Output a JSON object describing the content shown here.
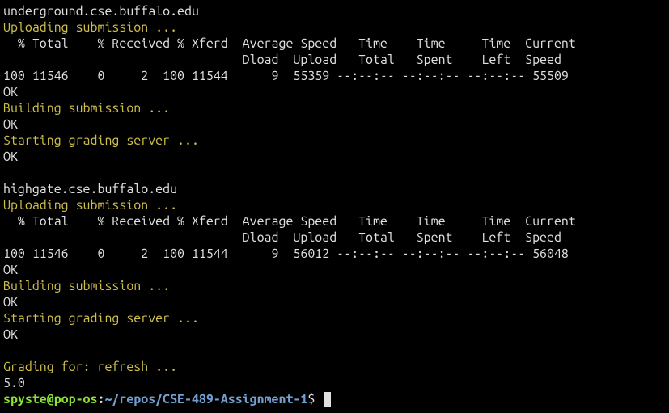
{
  "block1": {
    "host": "underground.cse.buffalo.edu",
    "uploading": "Uploading submission ...",
    "header1": "  % Total    % Received % Xferd  Average Speed   Time    Time     Time  Current",
    "header2": "                                 Dload  Upload   Total   Spent    Left  Speed",
    "progress": "100 11546    0     2  100 11544      9  55359 --:--:-- --:--:-- --:--:-- 55509",
    "ok1": "OK",
    "building": "Building submission ...",
    "ok2": "OK",
    "starting": "Starting grading server ...",
    "ok3": "OK"
  },
  "block2": {
    "host": "highgate.cse.buffalo.edu",
    "uploading": "Uploading submission ...",
    "header1": "  % Total    % Received % Xferd  Average Speed   Time    Time     Time  Current",
    "header2": "                                 Dload  Upload   Total   Spent    Left  Speed",
    "progress": "100 11546    0     2  100 11544      9  56012 --:--:-- --:--:-- --:--:-- 56048",
    "ok1": "OK",
    "building": "Building submission ...",
    "ok2": "OK",
    "starting": "Starting grading server ...",
    "ok3": "OK"
  },
  "grading": {
    "label": "Grading for: refresh ...",
    "score": "5.0"
  },
  "prompt": {
    "user": "spyste@pop-os",
    "colon": ":",
    "path": "~/repos/CSE-489-Assignment-1",
    "end": "$ "
  }
}
